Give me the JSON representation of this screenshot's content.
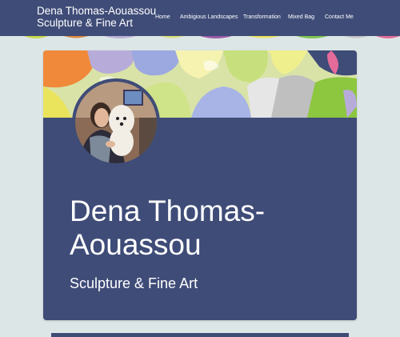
{
  "site": {
    "title_line1": "Dena Thomas-Aouassou",
    "title_line2": "Sculpture & Fine Art"
  },
  "nav": {
    "items": [
      {
        "label": "Home"
      },
      {
        "label": "Ambigious Landscapes"
      },
      {
        "label": "Transformation"
      },
      {
        "label": "Mixed Bag"
      },
      {
        "label": "Contact Me"
      }
    ]
  },
  "hero": {
    "name": "Dena Thomas-Aouassou",
    "tagline": "Sculpture & Fine Art",
    "avatar": "profile-photo-woman-with-dog"
  },
  "colors": {
    "brand": "#3f4c78",
    "background": "#dce6e6",
    "text": "#ffffff"
  }
}
